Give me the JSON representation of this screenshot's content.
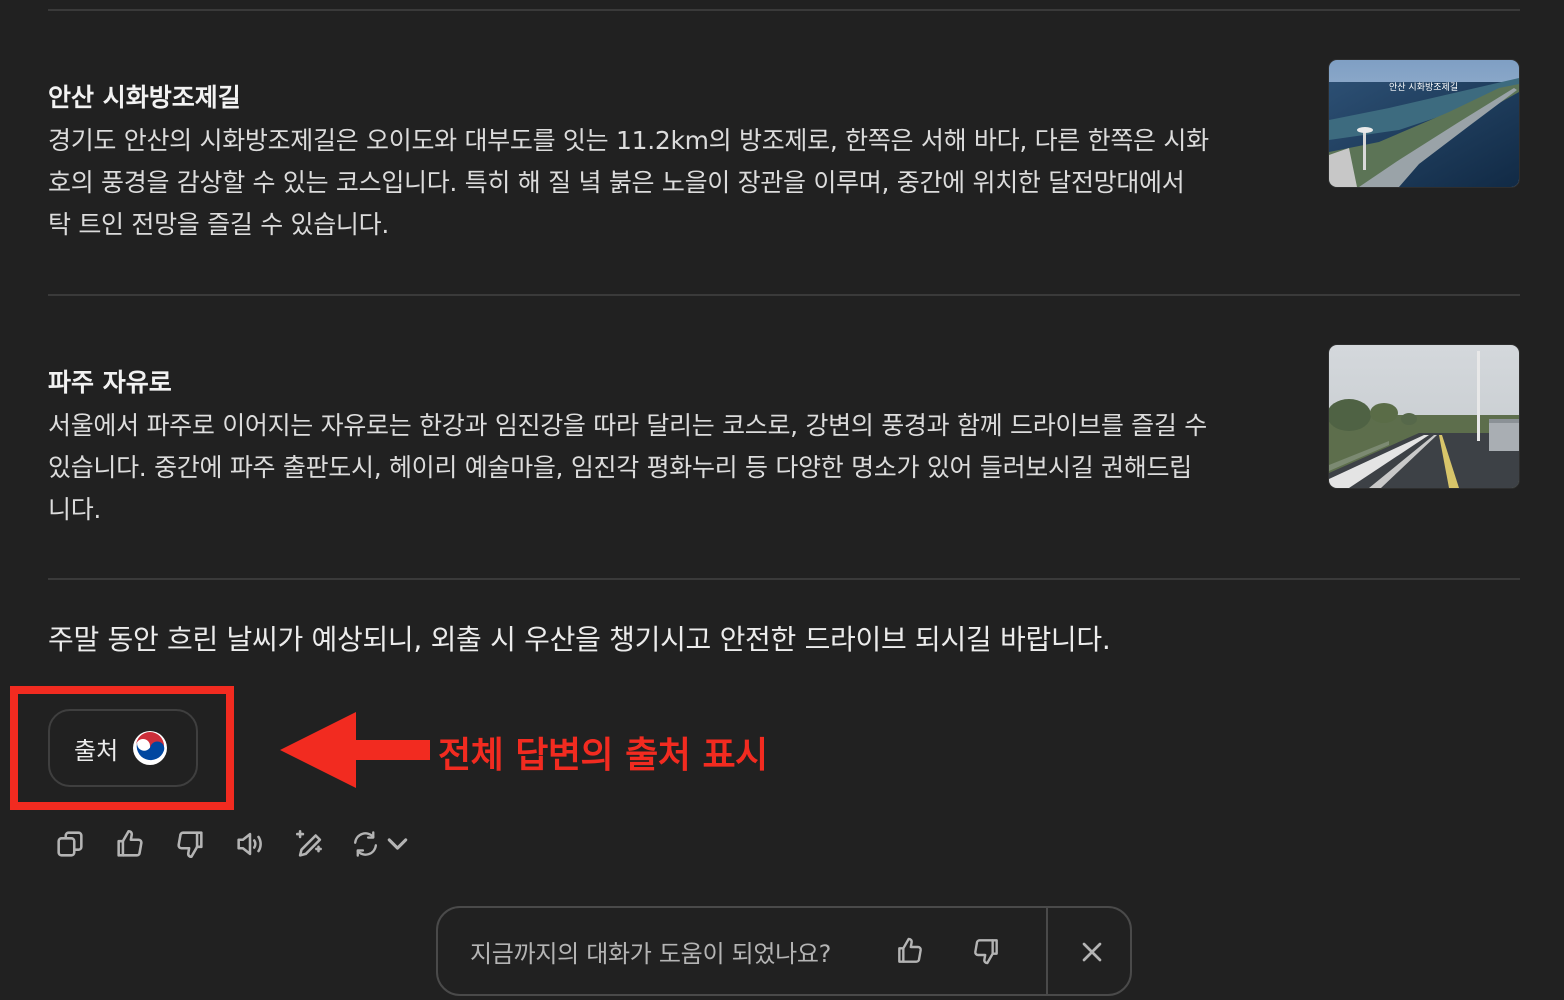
{
  "entries": [
    {
      "title": "안산 시화방조제길",
      "lines": [
        "경기도 안산의 시화방조제길은 오이도와 대부도를 잇는 11.2km의 방조제로, 한쪽은 서해 바다, 다른 한쪽은 시화",
        "호의 풍경을 감상할 수 있는 코스입니다. 특히 해 질 녘 붉은 노을이 장관을 이루며, 중간에 위치한 달전망대에서",
        "탁 트인 전망을 즐길 수 있습니다."
      ],
      "thumb_caption": "안산 시화방조제길"
    },
    {
      "title": "파주 자유로",
      "lines": [
        "서울에서 파주로 이어지는 자유로는 한강과 임진강을 따라 달리는 코스로, 강변의 풍경과 함께 드라이브를 즐길 수",
        "있습니다. 중간에 파주 출판도시, 헤이리 예술마을, 임진각 평화누리 등 다양한 명소가 있어 들러보시길 권해드립",
        "니다."
      ]
    }
  ],
  "closing": "주말 동안 흐린 날씨가 예상되니, 외출 시 우산을 챙기시고 안전한 드라이브 되시길 바랍니다.",
  "source_button": {
    "label": "출처",
    "icon": "taegeuk-icon"
  },
  "annotation": {
    "text": "전체 답변의 출처 표시",
    "color": "#f22b20"
  },
  "actions": [
    "copy-icon",
    "thumbs-up-icon",
    "thumbs-down-icon",
    "speaker-icon",
    "edit-sparkle-icon",
    "regenerate-icon"
  ],
  "feedback": {
    "question": "지금까지의 대화가 도움이 되었나요?"
  },
  "colors": {
    "background": "#212121",
    "text": "#ececec",
    "annotation": "#f22b20"
  }
}
